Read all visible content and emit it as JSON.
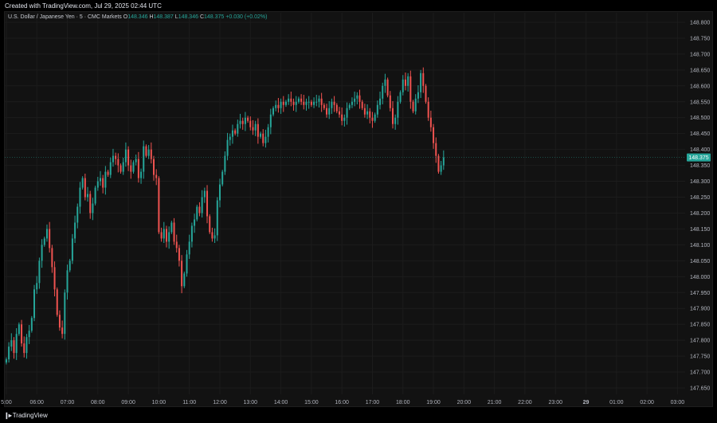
{
  "header": {
    "created_text": "Created with TradingView.com, Jul 29, 2025 02:44 UTC"
  },
  "legend": {
    "symbol": "U.S. Dollar / Japanese Yen · 5 · CMC Markets",
    "open_label": "O",
    "open": "148.346",
    "high_label": "H",
    "high": "148.387",
    "low_label": "L",
    "low": "148.346",
    "close_label": "C",
    "close": "148.375",
    "change": "+0.030 (+0.02%)"
  },
  "footer": {
    "brand": "TradingView"
  },
  "colors": {
    "up": "#26a69a",
    "down": "#ef5350",
    "background": "#121212",
    "grid": "#1c1c1c",
    "axis_text": "#b2b5be",
    "last_price_bg": "#26a69a"
  },
  "chart_data": {
    "type": "candlestick",
    "symbol": "USDJPY",
    "timeframe": "5",
    "ylim": [
      147.63,
      148.83
    ],
    "xlim": [
      4.95,
      27.25
    ],
    "y_ticks": [
      "148.800",
      "148.750",
      "148.700",
      "148.650",
      "148.600",
      "148.550",
      "148.500",
      "148.450",
      "148.400",
      "148.350",
      "148.300",
      "148.250",
      "148.200",
      "148.150",
      "148.100",
      "148.050",
      "148.000",
      "147.950",
      "147.900",
      "147.850",
      "147.800",
      "147.750",
      "147.700",
      "147.650"
    ],
    "x_ticks": [
      {
        "label": "5:00",
        "t": 5.0
      },
      {
        "label": "06:00",
        "t": 6.0
      },
      {
        "label": "07:00",
        "t": 7.0
      },
      {
        "label": "08:00",
        "t": 8.0
      },
      {
        "label": "09:00",
        "t": 9.0
      },
      {
        "label": "10:00",
        "t": 10.0
      },
      {
        "label": "11:00",
        "t": 11.0
      },
      {
        "label": "12:00",
        "t": 12.0
      },
      {
        "label": "13:00",
        "t": 13.0
      },
      {
        "label": "14:00",
        "t": 14.0
      },
      {
        "label": "15:00",
        "t": 15.0
      },
      {
        "label": "16:00",
        "t": 16.0
      },
      {
        "label": "17:00",
        "t": 17.0
      },
      {
        "label": "18:00",
        "t": 18.0
      },
      {
        "label": "19:00",
        "t": 19.0
      },
      {
        "label": "20:00",
        "t": 20.0
      },
      {
        "label": "21:00",
        "t": 21.0
      },
      {
        "label": "22:00",
        "t": 22.0
      },
      {
        "label": "23:00",
        "t": 23.0
      },
      {
        "label": "29",
        "t": 24.0
      },
      {
        "label": "01:00",
        "t": 25.0
      },
      {
        "label": "02:00",
        "t": 26.0
      },
      {
        "label": "03:00",
        "t": 27.0
      }
    ],
    "last_price": "148.375",
    "candles_x_start": 5.0,
    "candles_x_step": 0.0833333,
    "closes": [
      147.74,
      147.78,
      147.8,
      147.76,
      147.82,
      147.85,
      147.79,
      147.76,
      147.81,
      147.83,
      147.87,
      147.96,
      147.98,
      148.05,
      148.1,
      148.12,
      148.15,
      148.09,
      148.03,
      147.96,
      147.88,
      147.84,
      147.82,
      147.95,
      148.02,
      148.05,
      148.12,
      148.17,
      148.22,
      148.28,
      148.31,
      148.25,
      148.26,
      148.2,
      148.23,
      148.28,
      148.3,
      148.31,
      148.28,
      148.33,
      148.32,
      148.36,
      148.38,
      148.37,
      148.35,
      148.33,
      148.36,
      148.4,
      148.35,
      148.33,
      148.36,
      148.37,
      148.31,
      148.33,
      148.41,
      148.38,
      148.4,
      148.37,
      148.32,
      148.31,
      148.14,
      148.12,
      148.15,
      148.11,
      148.14,
      148.17,
      148.11,
      148.09,
      148.05,
      147.97,
      148.01,
      148.07,
      148.11,
      148.16,
      148.18,
      148.22,
      148.2,
      148.25,
      148.27,
      148.19,
      148.14,
      148.12,
      148.13,
      148.24,
      148.29,
      148.33,
      148.38,
      148.43,
      148.44,
      148.46,
      148.45,
      148.48,
      148.49,
      148.48,
      148.5,
      148.49,
      148.47,
      148.46,
      148.48,
      148.44,
      148.45,
      148.42,
      148.44,
      148.47,
      148.51,
      148.53,
      148.54,
      148.53,
      148.55,
      148.54,
      148.55,
      148.56,
      148.55,
      148.54,
      148.55,
      148.56,
      148.55,
      148.54,
      148.55,
      148.55,
      148.54,
      148.55,
      148.55,
      148.56,
      148.54,
      148.53,
      148.51,
      148.53,
      148.55,
      148.54,
      148.52,
      148.51,
      148.49,
      148.5,
      148.53,
      148.54,
      148.55,
      148.56,
      148.57,
      148.55,
      148.53,
      148.51,
      148.52,
      148.5,
      148.49,
      148.51,
      148.54,
      148.56,
      148.6,
      148.62,
      148.57,
      148.53,
      148.48,
      148.5,
      148.55,
      148.58,
      148.62,
      148.6,
      148.63,
      148.55,
      148.52,
      148.56,
      148.58,
      148.64,
      148.6,
      148.55,
      148.5,
      148.47,
      148.42,
      148.38,
      148.33,
      148.35,
      148.375
    ],
    "drop_note": "values read off the price axis; one candle per 5 minutes starting at 05:00"
  }
}
